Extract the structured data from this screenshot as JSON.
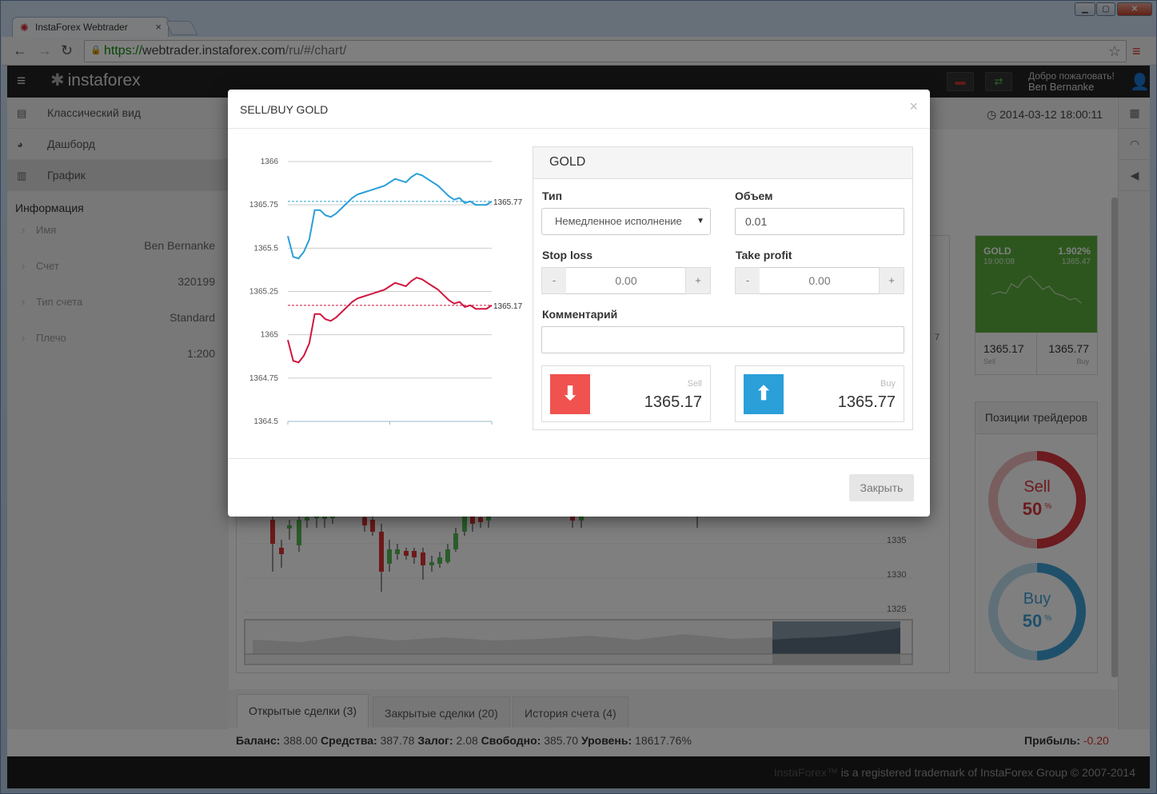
{
  "browser": {
    "tab_title": "InstaForex Webtrader",
    "url_scheme": "https://",
    "url_host": "webtrader.instaforex.com",
    "url_path": "/ru/#/chart/"
  },
  "app": {
    "logo_text": "instaforex",
    "welcome_label": "Добро пожаловать!",
    "user_name": "Ben Bernanke",
    "clock": "2014-03-12 18:00:11"
  },
  "sidebar": {
    "items": [
      {
        "label": "Классический вид",
        "icon": "list-icon"
      },
      {
        "label": "Дашборд",
        "icon": "dashboard-icon"
      },
      {
        "label": "График",
        "icon": "chart-icon"
      }
    ],
    "info_heading": "Информация",
    "info": [
      {
        "label": "Имя",
        "value": "Ben Bernanke"
      },
      {
        "label": "Счет",
        "value": "320199"
      },
      {
        "label": "Тип счета",
        "value": "Standard"
      },
      {
        "label": "Плечо",
        "value": "1:200"
      }
    ]
  },
  "background_chart": {
    "price_labels": [
      "1335",
      "1330",
      "1325"
    ],
    "partial_label": "7"
  },
  "gold_card": {
    "name": "GOLD",
    "change": "1.902%",
    "time": "19:00:08",
    "high": "1365.47",
    "sell": "1365.17",
    "buy": "1365.77",
    "sell_label": "Sell",
    "buy_label": "Buy",
    "color": "#5aad3c"
  },
  "positions": {
    "title": "Позиции трейдеров",
    "sell_label": "Sell",
    "sell_pct": 50,
    "buy_label": "Buy",
    "buy_pct": 50,
    "pct_sign": "%",
    "sell_color": "#d9363e",
    "buy_color": "#3ea1d6"
  },
  "bottom_tabs": [
    "Открытые сделки (3)",
    "Закрытые сделки (20)",
    "История счета (4)"
  ],
  "balance": {
    "balance_label": "Баланс:",
    "balance": "388.00",
    "equity_label": "Средства:",
    "equity": "387.78",
    "margin_label": "Залог:",
    "margin": "2.08",
    "free_label": "Свободно:",
    "free": "385.70",
    "level_label": "Уровень:",
    "level": "18617.76%",
    "profit_label": "Прибыль:",
    "profit": "-0.20"
  },
  "footer": {
    "brand": "InstaForex™",
    "text": " is a registered trademark of InstaForex Group © 2007-2014"
  },
  "modal": {
    "title": "SELL/BUY GOLD",
    "close_icon": "×",
    "panel_title": "GOLD",
    "type_label": "Тип",
    "type_value": "Немедленное исполнение",
    "volume_label": "Объем",
    "volume_value": "0.01",
    "stoploss_label": "Stop loss",
    "stoploss_value": "0.00",
    "takeprofit_label": "Take profit",
    "takeprofit_value": "0.00",
    "minus": "-",
    "plus": "+",
    "comment_label": "Комментарий",
    "comment_value": "",
    "sell_label": "Sell",
    "sell_price": "1365.17",
    "buy_label": "Buy",
    "buy_price": "1365.77",
    "close_button": "Закрыть",
    "sell_color": "#f0524f",
    "buy_color": "#2a9fd8"
  },
  "chart_data": {
    "type": "line",
    "title": "",
    "xlabel": "",
    "ylabel": "",
    "ylim": [
      1364.5,
      1366
    ],
    "yticks": [
      "1366",
      "1365.75",
      "1365.5",
      "1365.25",
      "1365",
      "1364.75",
      "1364.5"
    ],
    "x": [
      0,
      1,
      2,
      3,
      4,
      5,
      6,
      7,
      8,
      9,
      10,
      11,
      12,
      13,
      14,
      15,
      16,
      17,
      18,
      19,
      20,
      21,
      22,
      23,
      24,
      25,
      26,
      27,
      28,
      29,
      30,
      31,
      32,
      33,
      34,
      35,
      36,
      37,
      38
    ],
    "series": [
      {
        "color": "#2a9fd8",
        "values": [
          1365.57,
          1365.45,
          1365.44,
          1365.48,
          1365.55,
          1365.72,
          1365.72,
          1365.69,
          1365.68,
          1365.7,
          1365.73,
          1365.76,
          1365.79,
          1365.81,
          1365.82,
          1365.83,
          1365.84,
          1365.85,
          1365.86,
          1365.88,
          1365.9,
          1365.89,
          1365.88,
          1365.91,
          1365.93,
          1365.92,
          1365.9,
          1365.88,
          1365.86,
          1365.83,
          1365.8,
          1365.78,
          1365.79,
          1365.76,
          1365.77,
          1365.75,
          1365.75,
          1365.75,
          1365.77
        ]
      },
      {
        "color": "#d0163f",
        "values": [
          1364.97,
          1364.85,
          1364.84,
          1364.88,
          1364.95,
          1365.12,
          1365.12,
          1365.09,
          1365.08,
          1365.1,
          1365.13,
          1365.16,
          1365.19,
          1365.21,
          1365.22,
          1365.23,
          1365.24,
          1365.25,
          1365.26,
          1365.28,
          1365.3,
          1365.29,
          1365.28,
          1365.31,
          1365.33,
          1365.32,
          1365.3,
          1365.28,
          1365.26,
          1365.23,
          1365.2,
          1365.18,
          1365.19,
          1365.16,
          1365.17,
          1365.15,
          1365.15,
          1365.15,
          1365.17
        ]
      }
    ],
    "reference_lines": [
      {
        "value": 1365.77,
        "label": "1365.77",
        "color": "#2a9fd8"
      },
      {
        "value": 1365.17,
        "label": "1365.17",
        "color": "#d0163f"
      }
    ],
    "grid": true
  }
}
